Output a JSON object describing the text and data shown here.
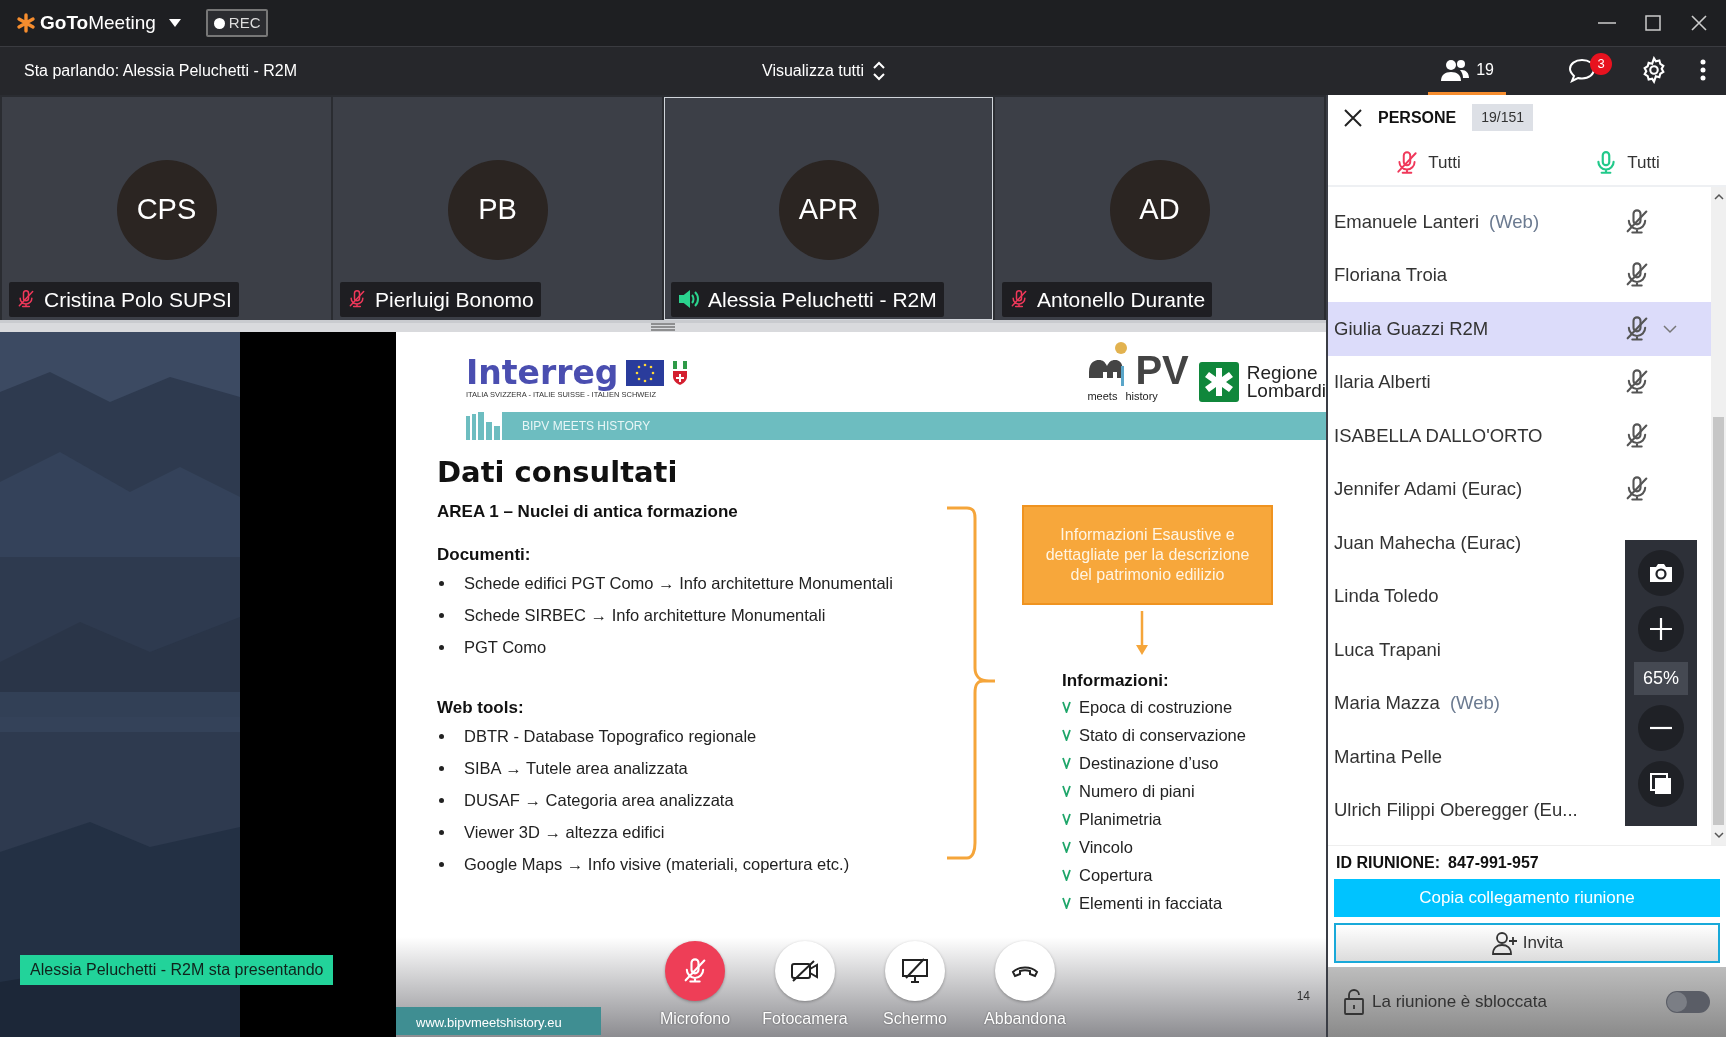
{
  "app": {
    "name_bold": "GoTo",
    "name": "Meeting",
    "rec_label": "REC"
  },
  "toolbar": {
    "speaking": "Sta parlando: Alessia Peluchetti - R2M",
    "view_label": "Visualizza tutti",
    "people_count": "19",
    "people_selected": true,
    "chat_badge": "3"
  },
  "tiles": [
    {
      "initials": "CPS",
      "name": "Cristina Polo SUPSI",
      "speaking": false,
      "selected": false
    },
    {
      "initials": "PB",
      "name": "Pierluigi Bonomo",
      "speaking": false,
      "selected": false
    },
    {
      "initials": "APR",
      "name": "Alessia Peluchetti - R2M",
      "speaking": true,
      "selected": true
    },
    {
      "initials": "AD",
      "name": "Antonello Durante",
      "speaking": false,
      "selected": false
    }
  ],
  "presentation": {
    "presenter_label": "Alessia Peluchetti - R2M sta presentando",
    "slide": {
      "logo_interreg": "Interreg",
      "logo_interreg_sub": "ITALIA SVIZZERA - ITALIE SUISSE - ITALIEN SCHWEIZ",
      "logo_mipv": "PV",
      "logo_mipv_sub": [
        "meets",
        "history"
      ],
      "logo_region": [
        "Regione",
        "Lombardi"
      ],
      "band": "BIPV MEETS HISTORY",
      "title": "Dati consultati",
      "subtitle": "AREA 1 – Nuclei di antica formazione",
      "sections": [
        {
          "heading": "Documenti:",
          "items": [
            "Schede edifici PGT Como → Info architetture Monumentali",
            "Schede SIRBEC → Info architetture Monumentali",
            "PGT Como"
          ]
        },
        {
          "heading": "Web tools:",
          "items": [
            "DBTR - Database Topografico regionale",
            "SIBA → Tutele area analizzata",
            "DUSAF → Categoria area analizzata",
            "Viewer 3D → altezza edifici",
            "Google Maps → Info visive (materiali, copertura etc.)"
          ]
        }
      ],
      "callout": "Informazioni Esaustive e dettagliate per la descrizione del patrimonio edilizio",
      "info_heading": "Informazioni:",
      "info_items": [
        "Epoca di costruzione",
        "Stato di conservazione",
        "Destinazione d’uso",
        "Numero di piani",
        "Planimetria",
        "Vincolo",
        "Copertura",
        "Elementi in facciata"
      ],
      "footer_url": "www.bipvmeetshistory.eu",
      "page_number": "14"
    }
  },
  "controls": [
    {
      "kind": "mic",
      "label": "Microfono",
      "muted": true
    },
    {
      "kind": "camera",
      "label": "Fotocamera",
      "muted": false
    },
    {
      "kind": "screen",
      "label": "Schermo",
      "muted": false
    },
    {
      "kind": "leave",
      "label": "Abbandona",
      "muted": false
    }
  ],
  "people": {
    "title": "PERSONE",
    "count": "19/151",
    "mute_all_label": "Tutti",
    "unmute_all_label": "Tutti",
    "list": [
      {
        "name": "Emanuele Lanteri",
        "tag": "(Web)",
        "selected": false,
        "muted": true
      },
      {
        "name": "Floriana Troia",
        "selected": false,
        "muted": true
      },
      {
        "name": "Giulia Guazzi R2M",
        "selected": true,
        "muted": true
      },
      {
        "name": "Ilaria Alberti",
        "selected": false,
        "muted": true
      },
      {
        "name": "ISABELLA DALLO'ORTO",
        "selected": false,
        "muted": true
      },
      {
        "name": "Jennifer Adami (Eurac)",
        "selected": false,
        "muted": true
      },
      {
        "name": "Juan Mahecha (Eurac)",
        "selected": false
      },
      {
        "name": "Linda Toledo",
        "selected": false
      },
      {
        "name": "Luca Trapani",
        "selected": false
      },
      {
        "name": "Maria Mazza",
        "tag": "(Web)",
        "selected": false
      },
      {
        "name": "Martina Pelle",
        "selected": false
      },
      {
        "name": "Ulrich Filippi Oberegger (Eu...",
        "selected": false
      }
    ],
    "zoom_level": "65%",
    "meeting_id_label": "ID RIUNIONE:",
    "meeting_id": "847-991-957",
    "copy_link": "Copia collegamento riunione",
    "invite": "Invita",
    "lock_label": "La riunione è sbloccata",
    "lock_on": false
  }
}
